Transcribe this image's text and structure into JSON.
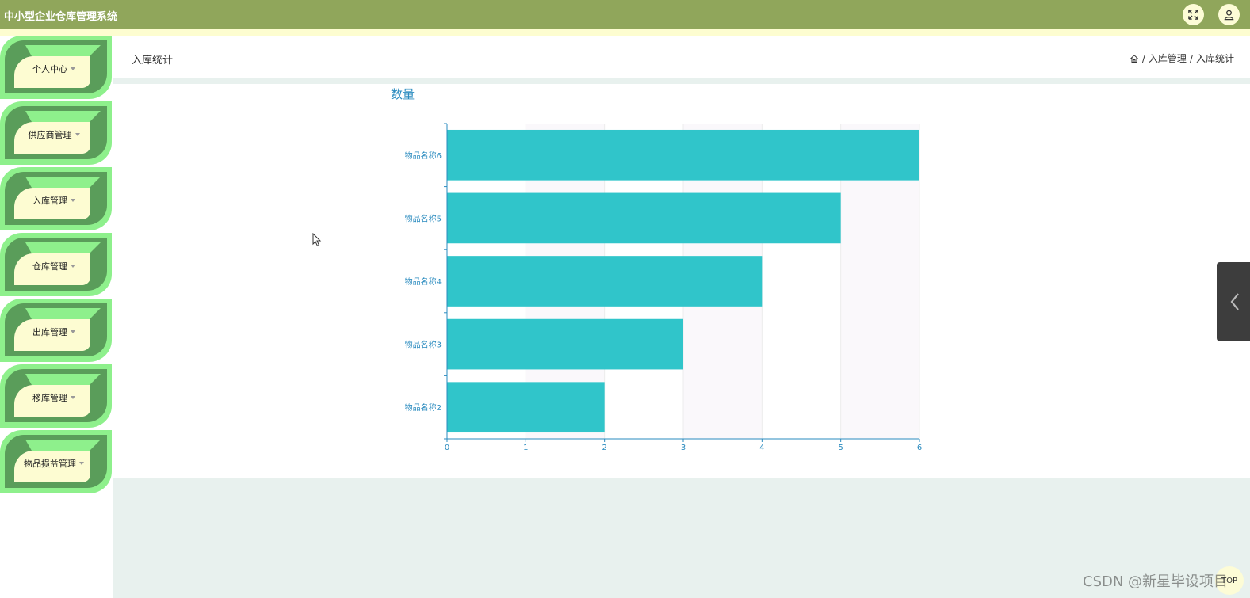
{
  "app": {
    "title": "中小型企业仓库管理系统"
  },
  "topbar": {
    "fullscreen_icon": "fullscreen-icon",
    "user_icon": "user-icon"
  },
  "sidebar": {
    "items": [
      {
        "label": "个人中心"
      },
      {
        "label": "供应商管理"
      },
      {
        "label": "入库管理"
      },
      {
        "label": "仓库管理"
      },
      {
        "label": "出库管理"
      },
      {
        "label": "移库管理"
      },
      {
        "label": "物品损益管理"
      }
    ]
  },
  "header": {
    "page_title": "入库统计",
    "breadcrumb": [
      "入库管理",
      "入库统计"
    ],
    "separator": "/"
  },
  "chart_data": {
    "type": "bar",
    "orientation": "horizontal",
    "title": "数量",
    "categories": [
      "物品名称6",
      "物品名称5",
      "物品名称4",
      "物品名称3",
      "物品名称2"
    ],
    "values": [
      6,
      5,
      4,
      3,
      2
    ],
    "xlim": [
      0,
      6
    ],
    "x_ticks": [
      "0",
      "1",
      "2",
      "3",
      "4",
      "5",
      "6"
    ],
    "grid": true,
    "bar_color": "#30c5ca",
    "axis_color": "#2a8bbf"
  },
  "footer": {
    "top_button": "TOP",
    "watermark": "CSDN @新星毕设项目"
  },
  "colors": {
    "topbar": "#90a65b",
    "accent": "#2a8bbf"
  }
}
